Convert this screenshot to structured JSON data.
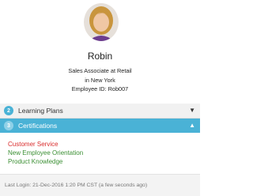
{
  "profile": {
    "name": "Robin",
    "title": "Sales Associate at Retail",
    "location": "in New York",
    "employee_id": "Employee ID: Rob007"
  },
  "panels": [
    {
      "badge": "2",
      "label": "Learning Plans",
      "caret": "▼",
      "expanded": false
    },
    {
      "badge": "3",
      "label": "Certifications",
      "caret": "▲",
      "expanded": true
    }
  ],
  "certifications": [
    "Customer Service",
    "New Employee Orientation",
    "Product Knowledge"
  ],
  "footer": {
    "last_login": "Last Login: 21-Dec-2016 1:20 PM CST (a few seconds ago)"
  },
  "colors": {
    "accent": "#4ab2d6",
    "link": "#3b8f33",
    "active_link": "#d92c2c"
  },
  "icons": {
    "avatar": "user-photo",
    "collapse": "caret-down-icon",
    "expand": "caret-up-icon"
  }
}
